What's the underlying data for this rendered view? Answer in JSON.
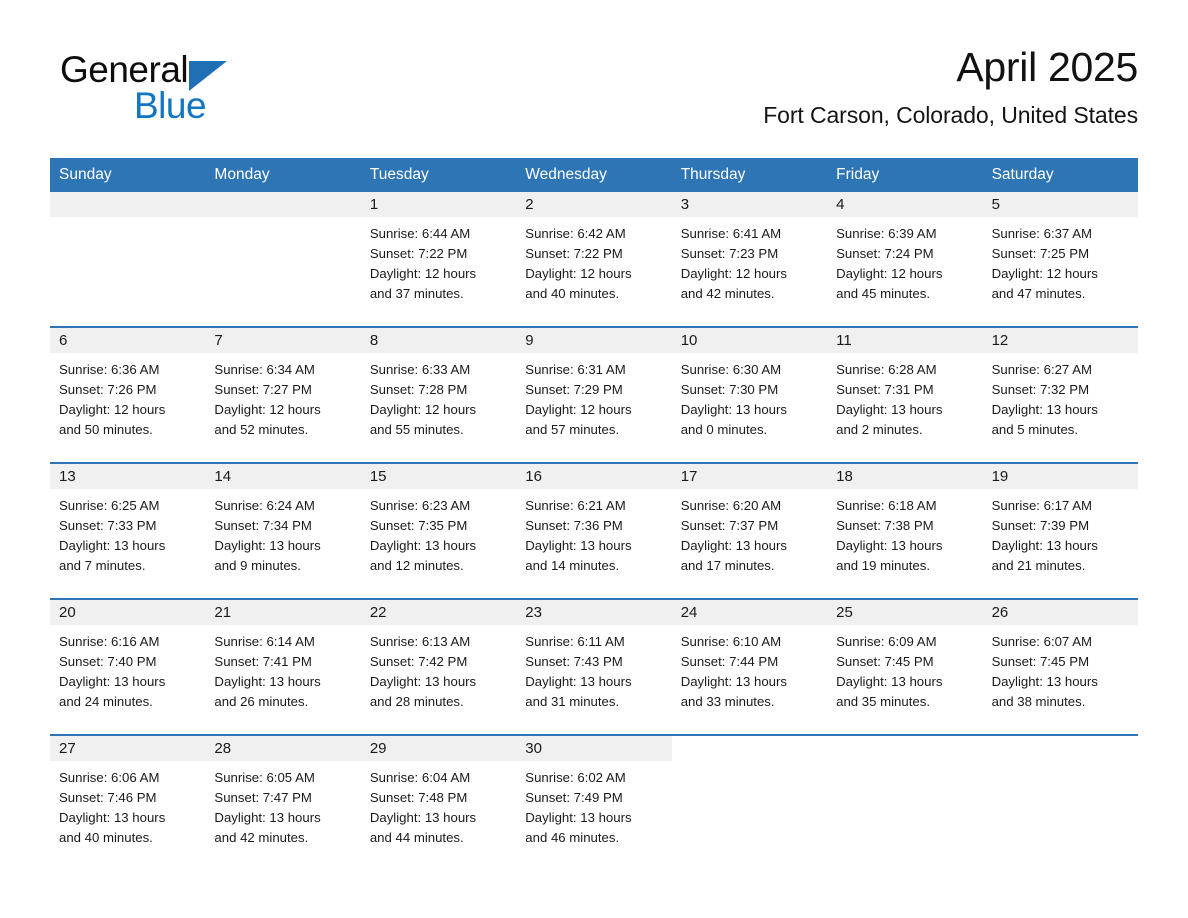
{
  "brand": {
    "name_part1": "General",
    "name_part2": "Blue",
    "triangle_color": "#1F6FB5",
    "blue_text_color": "#1076C4"
  },
  "header": {
    "title": "April 2025",
    "subtitle": "Fort Carson, Colorado, United States"
  },
  "theme": {
    "header_blue": "#2E75B6",
    "date_band_gray": "#F0F0F0",
    "text_color": "#1a1a1a"
  },
  "weekdays": [
    "Sunday",
    "Monday",
    "Tuesday",
    "Wednesday",
    "Thursday",
    "Friday",
    "Saturday"
  ],
  "weeks": [
    [
      {
        "day": "",
        "empty": true,
        "sunrise": "",
        "sunset": "",
        "daylight_line1": "",
        "daylight_line2": ""
      },
      {
        "day": "",
        "empty": true,
        "sunrise": "",
        "sunset": "",
        "daylight_line1": "",
        "daylight_line2": ""
      },
      {
        "day": "1",
        "sunrise": "Sunrise: 6:44 AM",
        "sunset": "Sunset: 7:22 PM",
        "daylight_line1": "Daylight: 12 hours",
        "daylight_line2": "and 37 minutes."
      },
      {
        "day": "2",
        "sunrise": "Sunrise: 6:42 AM",
        "sunset": "Sunset: 7:22 PM",
        "daylight_line1": "Daylight: 12 hours",
        "daylight_line2": "and 40 minutes."
      },
      {
        "day": "3",
        "sunrise": "Sunrise: 6:41 AM",
        "sunset": "Sunset: 7:23 PM",
        "daylight_line1": "Daylight: 12 hours",
        "daylight_line2": "and 42 minutes."
      },
      {
        "day": "4",
        "sunrise": "Sunrise: 6:39 AM",
        "sunset": "Sunset: 7:24 PM",
        "daylight_line1": "Daylight: 12 hours",
        "daylight_line2": "and 45 minutes."
      },
      {
        "day": "5",
        "sunrise": "Sunrise: 6:37 AM",
        "sunset": "Sunset: 7:25 PM",
        "daylight_line1": "Daylight: 12 hours",
        "daylight_line2": "and 47 minutes."
      }
    ],
    [
      {
        "day": "6",
        "sunrise": "Sunrise: 6:36 AM",
        "sunset": "Sunset: 7:26 PM",
        "daylight_line1": "Daylight: 12 hours",
        "daylight_line2": "and 50 minutes."
      },
      {
        "day": "7",
        "sunrise": "Sunrise: 6:34 AM",
        "sunset": "Sunset: 7:27 PM",
        "daylight_line1": "Daylight: 12 hours",
        "daylight_line2": "and 52 minutes."
      },
      {
        "day": "8",
        "sunrise": "Sunrise: 6:33 AM",
        "sunset": "Sunset: 7:28 PM",
        "daylight_line1": "Daylight: 12 hours",
        "daylight_line2": "and 55 minutes."
      },
      {
        "day": "9",
        "sunrise": "Sunrise: 6:31 AM",
        "sunset": "Sunset: 7:29 PM",
        "daylight_line1": "Daylight: 12 hours",
        "daylight_line2": "and 57 minutes."
      },
      {
        "day": "10",
        "sunrise": "Sunrise: 6:30 AM",
        "sunset": "Sunset: 7:30 PM",
        "daylight_line1": "Daylight: 13 hours",
        "daylight_line2": "and 0 minutes."
      },
      {
        "day": "11",
        "sunrise": "Sunrise: 6:28 AM",
        "sunset": "Sunset: 7:31 PM",
        "daylight_line1": "Daylight: 13 hours",
        "daylight_line2": "and 2 minutes."
      },
      {
        "day": "12",
        "sunrise": "Sunrise: 6:27 AM",
        "sunset": "Sunset: 7:32 PM",
        "daylight_line1": "Daylight: 13 hours",
        "daylight_line2": "and 5 minutes."
      }
    ],
    [
      {
        "day": "13",
        "sunrise": "Sunrise: 6:25 AM",
        "sunset": "Sunset: 7:33 PM",
        "daylight_line1": "Daylight: 13 hours",
        "daylight_line2": "and 7 minutes."
      },
      {
        "day": "14",
        "sunrise": "Sunrise: 6:24 AM",
        "sunset": "Sunset: 7:34 PM",
        "daylight_line1": "Daylight: 13 hours",
        "daylight_line2": "and 9 minutes."
      },
      {
        "day": "15",
        "sunrise": "Sunrise: 6:23 AM",
        "sunset": "Sunset: 7:35 PM",
        "daylight_line1": "Daylight: 13 hours",
        "daylight_line2": "and 12 minutes."
      },
      {
        "day": "16",
        "sunrise": "Sunrise: 6:21 AM",
        "sunset": "Sunset: 7:36 PM",
        "daylight_line1": "Daylight: 13 hours",
        "daylight_line2": "and 14 minutes."
      },
      {
        "day": "17",
        "sunrise": "Sunrise: 6:20 AM",
        "sunset": "Sunset: 7:37 PM",
        "daylight_line1": "Daylight: 13 hours",
        "daylight_line2": "and 17 minutes."
      },
      {
        "day": "18",
        "sunrise": "Sunrise: 6:18 AM",
        "sunset": "Sunset: 7:38 PM",
        "daylight_line1": "Daylight: 13 hours",
        "daylight_line2": "and 19 minutes."
      },
      {
        "day": "19",
        "sunrise": "Sunrise: 6:17 AM",
        "sunset": "Sunset: 7:39 PM",
        "daylight_line1": "Daylight: 13 hours",
        "daylight_line2": "and 21 minutes."
      }
    ],
    [
      {
        "day": "20",
        "sunrise": "Sunrise: 6:16 AM",
        "sunset": "Sunset: 7:40 PM",
        "daylight_line1": "Daylight: 13 hours",
        "daylight_line2": "and 24 minutes."
      },
      {
        "day": "21",
        "sunrise": "Sunrise: 6:14 AM",
        "sunset": "Sunset: 7:41 PM",
        "daylight_line1": "Daylight: 13 hours",
        "daylight_line2": "and 26 minutes."
      },
      {
        "day": "22",
        "sunrise": "Sunrise: 6:13 AM",
        "sunset": "Sunset: 7:42 PM",
        "daylight_line1": "Daylight: 13 hours",
        "daylight_line2": "and 28 minutes."
      },
      {
        "day": "23",
        "sunrise": "Sunrise: 6:11 AM",
        "sunset": "Sunset: 7:43 PM",
        "daylight_line1": "Daylight: 13 hours",
        "daylight_line2": "and 31 minutes."
      },
      {
        "day": "24",
        "sunrise": "Sunrise: 6:10 AM",
        "sunset": "Sunset: 7:44 PM",
        "daylight_line1": "Daylight: 13 hours",
        "daylight_line2": "and 33 minutes."
      },
      {
        "day": "25",
        "sunrise": "Sunrise: 6:09 AM",
        "sunset": "Sunset: 7:45 PM",
        "daylight_line1": "Daylight: 13 hours",
        "daylight_line2": "and 35 minutes."
      },
      {
        "day": "26",
        "sunrise": "Sunrise: 6:07 AM",
        "sunset": "Sunset: 7:45 PM",
        "daylight_line1": "Daylight: 13 hours",
        "daylight_line2": "and 38 minutes."
      }
    ],
    [
      {
        "day": "27",
        "sunrise": "Sunrise: 6:06 AM",
        "sunset": "Sunset: 7:46 PM",
        "daylight_line1": "Daylight: 13 hours",
        "daylight_line2": "and 40 minutes."
      },
      {
        "day": "28",
        "sunrise": "Sunrise: 6:05 AM",
        "sunset": "Sunset: 7:47 PM",
        "daylight_line1": "Daylight: 13 hours",
        "daylight_line2": "and 42 minutes."
      },
      {
        "day": "29",
        "sunrise": "Sunrise: 6:04 AM",
        "sunset": "Sunset: 7:48 PM",
        "daylight_line1": "Daylight: 13 hours",
        "daylight_line2": "and 44 minutes."
      },
      {
        "day": "30",
        "sunrise": "Sunrise: 6:02 AM",
        "sunset": "Sunset: 7:49 PM",
        "daylight_line1": "Daylight: 13 hours",
        "daylight_line2": "and 46 minutes."
      },
      {
        "day": "",
        "blank": true,
        "sunrise": "",
        "sunset": "",
        "daylight_line1": "",
        "daylight_line2": ""
      },
      {
        "day": "",
        "blank": true,
        "sunrise": "",
        "sunset": "",
        "daylight_line1": "",
        "daylight_line2": ""
      },
      {
        "day": "",
        "blank": true,
        "sunrise": "",
        "sunset": "",
        "daylight_line1": "",
        "daylight_line2": ""
      }
    ]
  ]
}
